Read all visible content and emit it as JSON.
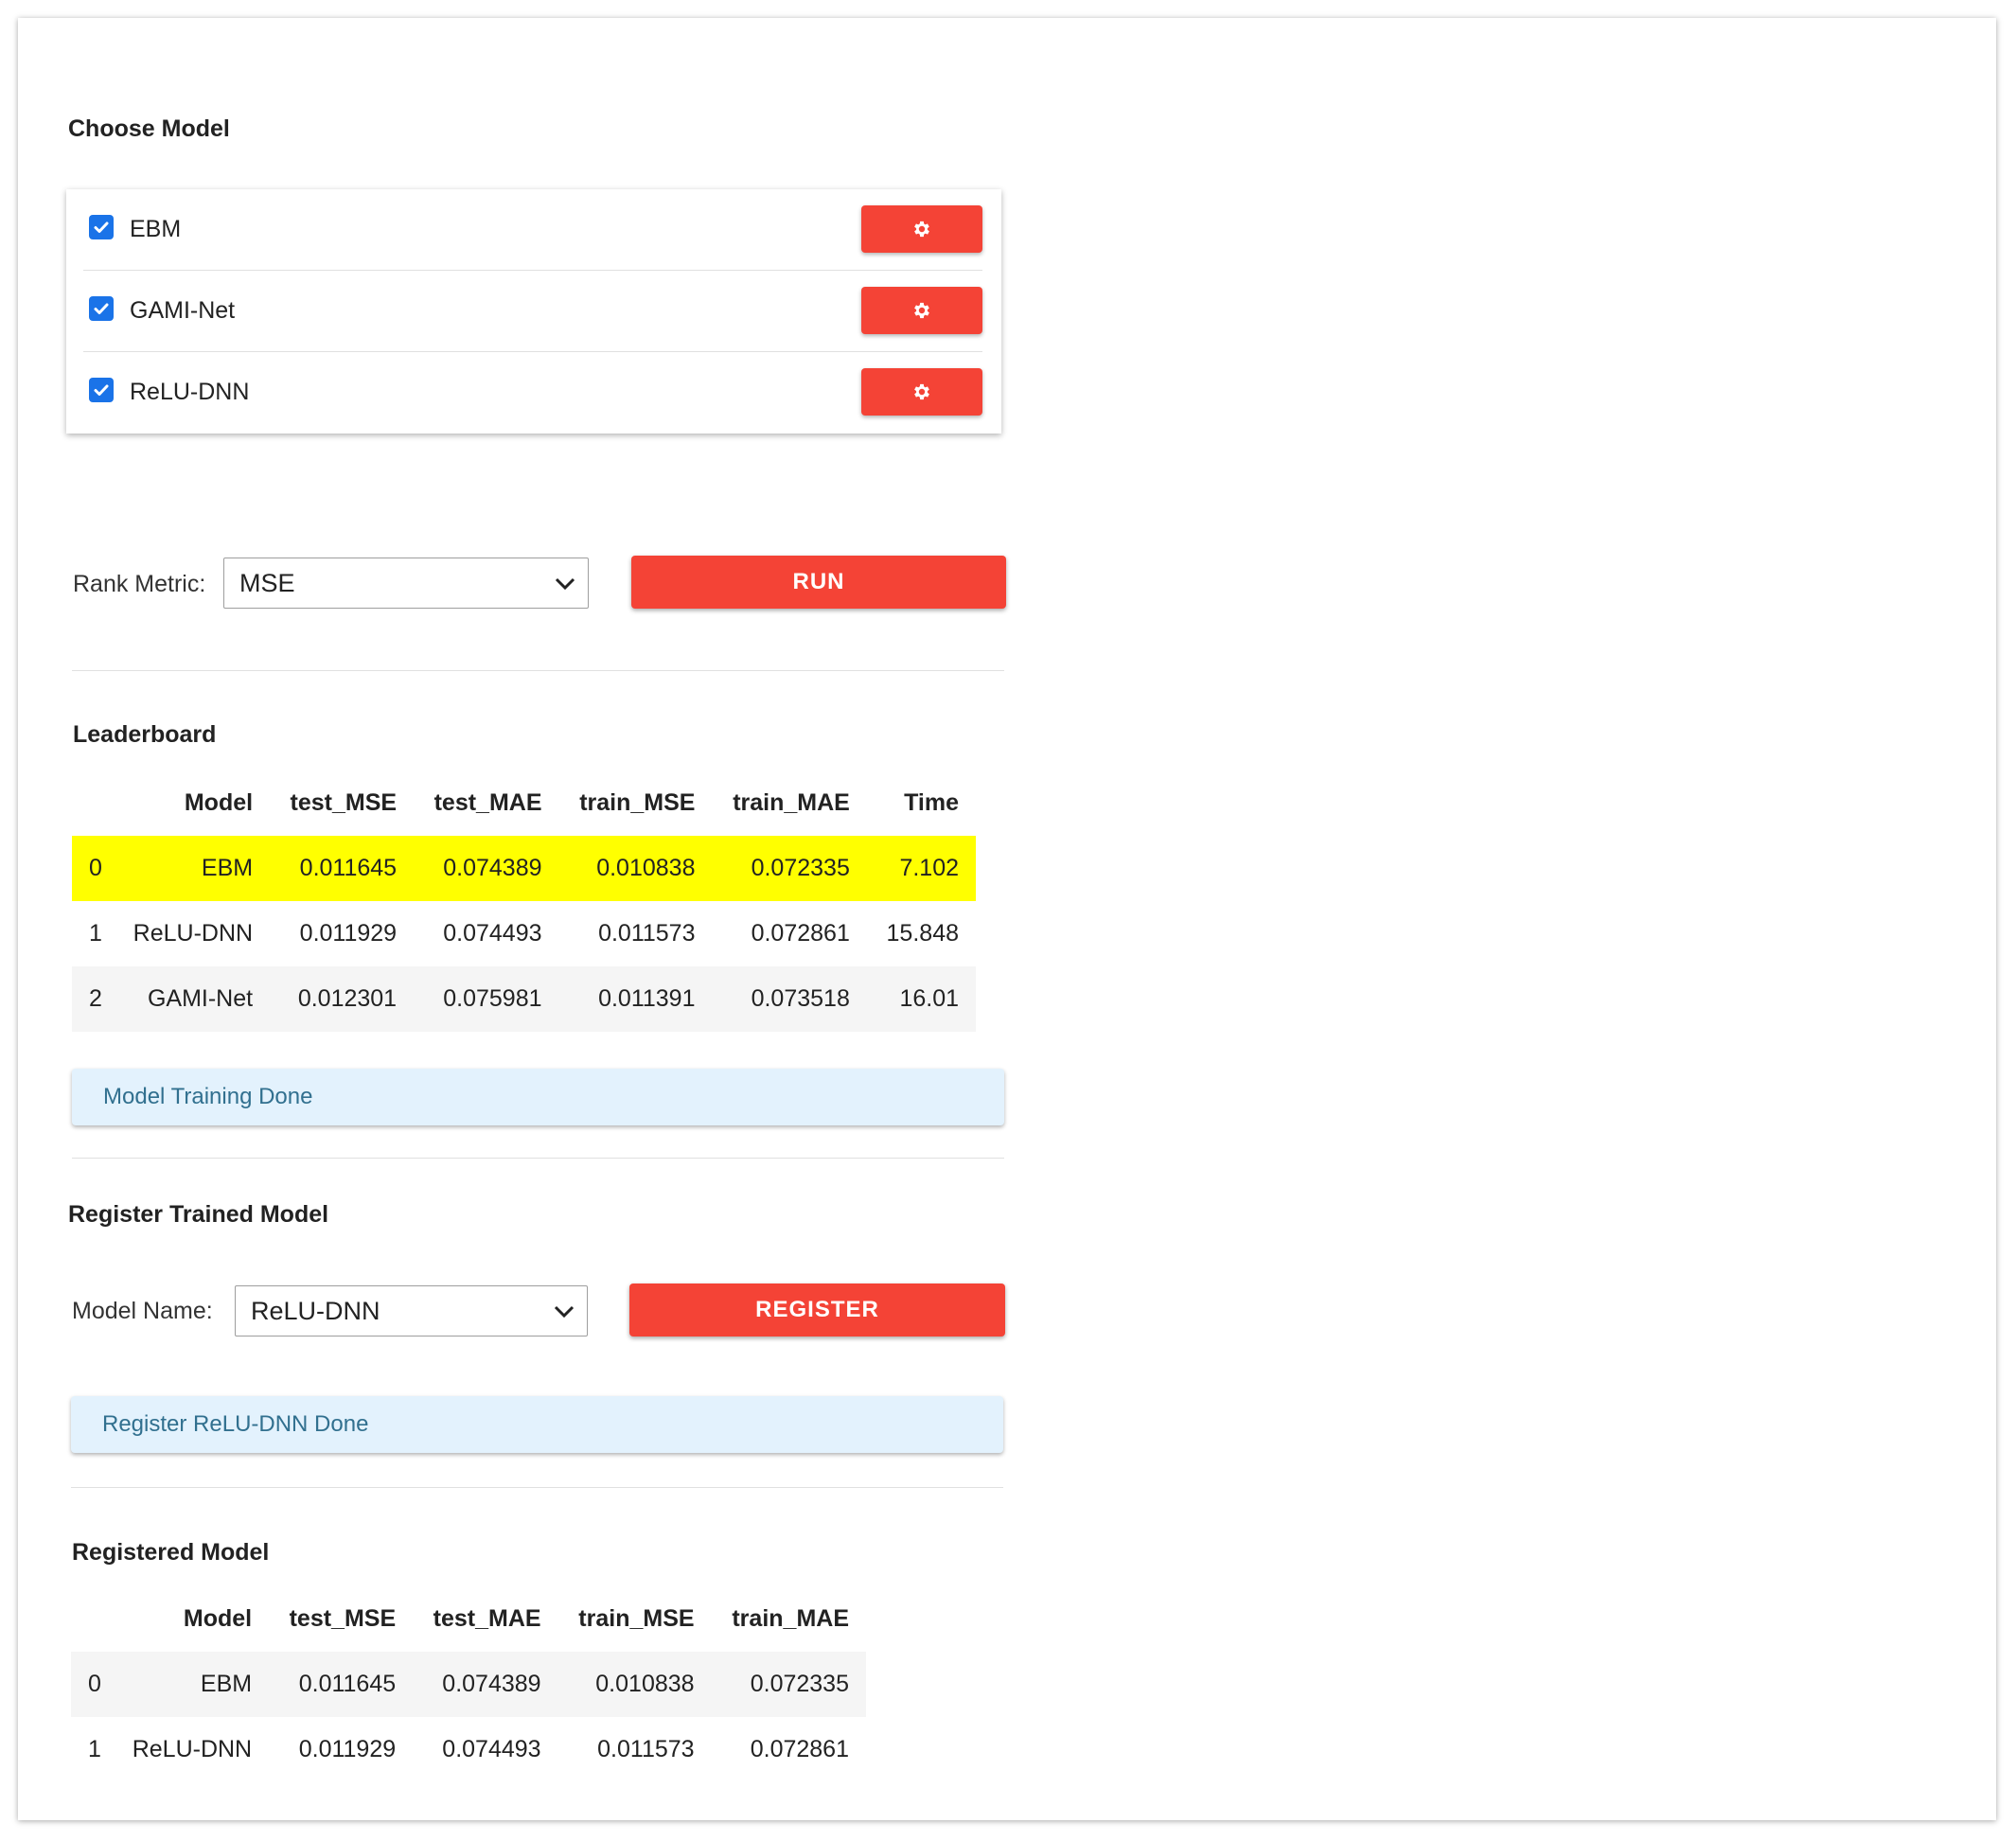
{
  "choose_model": {
    "title": "Choose Model",
    "models": [
      {
        "label": "EBM",
        "checked": true
      },
      {
        "label": "GAMI-Net",
        "checked": true
      },
      {
        "label": "ReLU-DNN",
        "checked": true
      }
    ]
  },
  "rank": {
    "label": "Rank Metric:",
    "selected": "MSE",
    "run_label": "RUN"
  },
  "leaderboard": {
    "title": "Leaderboard",
    "columns": [
      "",
      "Model",
      "test_MSE",
      "test_MAE",
      "train_MSE",
      "train_MAE",
      "Time"
    ],
    "rows": [
      [
        "0",
        "EBM",
        "0.011645",
        "0.074389",
        "0.010838",
        "0.072335",
        "7.102"
      ],
      [
        "1",
        "ReLU-DNN",
        "0.011929",
        "0.074493",
        "0.011573",
        "0.072861",
        "15.848"
      ],
      [
        "2",
        "GAMI-Net",
        "0.012301",
        "0.075981",
        "0.011391",
        "0.073518",
        "16.01"
      ]
    ],
    "highlight_color": "#ffff00"
  },
  "training_alert": "Model Training Done",
  "register": {
    "title": "Register Trained Model",
    "label": "Model Name:",
    "selected": "ReLU-DNN",
    "button_label": "REGISTER",
    "alert": "Register ReLU-DNN Done"
  },
  "registered": {
    "title": "Registered Model",
    "columns": [
      "",
      "Model",
      "test_MSE",
      "test_MAE",
      "train_MSE",
      "train_MAE"
    ],
    "rows": [
      [
        "0",
        "EBM",
        "0.011645",
        "0.074389",
        "0.010838",
        "0.072335"
      ],
      [
        "1",
        "ReLU-DNN",
        "0.011929",
        "0.074493",
        "0.011573",
        "0.072861"
      ]
    ]
  },
  "colors": {
    "accent_red": "#f44336",
    "checkbox_blue": "#1a73e8",
    "alert_bg": "#e3f2fd",
    "alert_text": "#31708f"
  },
  "icons": {
    "settings": "gear-icon",
    "checkbox": "checkmark-icon",
    "dropdown": "chevron-down-icon"
  }
}
